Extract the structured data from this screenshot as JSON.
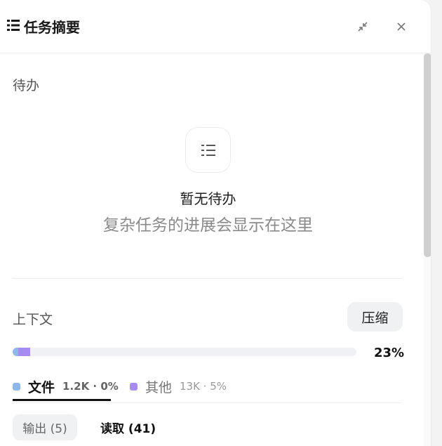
{
  "header": {
    "title": "任务摘要",
    "title_icon": "list-icon",
    "expand_icon": "collapse-arrows-icon",
    "close_icon": "close-icon"
  },
  "todo": {
    "label": "待办",
    "empty_icon": "list-icon",
    "empty_title": "暂无待办",
    "empty_subtitle": "复杂任务的进展会显示在这里"
  },
  "context": {
    "label": "上下文",
    "compress_label": "压缩",
    "usage_percent": "23%",
    "usage": {
      "files_fraction": 0.005,
      "other_fraction": 0.05,
      "files_color": "#8fb8ea",
      "other_color": "#a78bf0"
    },
    "legend": {
      "files": {
        "name": "文件",
        "stat": "1.2K · 0%",
        "color": "#8fb8ea"
      },
      "other": {
        "name": "其他",
        "stat": "13K · 5%",
        "color": "#a78bf0"
      }
    },
    "sub_tabs": {
      "output": "输出 (5)",
      "read": "读取 (41)"
    }
  }
}
